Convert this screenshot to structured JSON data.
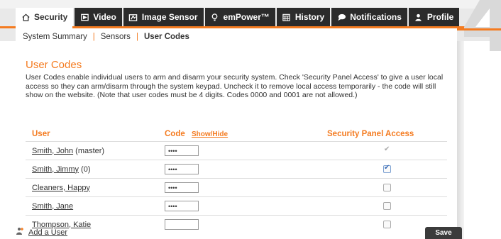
{
  "tabs": [
    {
      "label": "Security",
      "icon": "home-icon",
      "active": true
    },
    {
      "label": "Video",
      "icon": "video-icon",
      "active": false
    },
    {
      "label": "Image Sensor",
      "icon": "image-sensor-icon",
      "active": false
    },
    {
      "label": "emPower™",
      "icon": "lightbulb-icon",
      "active": false
    },
    {
      "label": "History",
      "icon": "calendar-icon",
      "active": false
    },
    {
      "label": "Notifications",
      "icon": "speech-bubble-icon",
      "active": false
    },
    {
      "label": "Profile",
      "icon": "person-icon",
      "active": false
    }
  ],
  "subnav": {
    "items": [
      "System Summary",
      "Sensors",
      "User Codes"
    ],
    "separator": "|"
  },
  "page": {
    "title": "User Codes",
    "description": "User Codes enable individual users to arm and disarm your security system. Check 'Security Panel Access' to give a user local access so they can arm/disarm through the system keypad. Uncheck it to remove local access temporarily - the code will still show on the website. (Note that user codes must be 4 digits. Codes 0000 and 0001 are not allowed.)"
  },
  "table": {
    "columns": {
      "user": "User",
      "code": "Code",
      "show_hide": "Show/Hide",
      "access": "Security Panel Access"
    },
    "rows": [
      {
        "name": "Smith, John",
        "suffix": " (master)",
        "code": "••••",
        "access": "checked-disabled"
      },
      {
        "name": "Smith, Jimmy",
        "suffix": " (0)",
        "code": "••••",
        "access": "checked"
      },
      {
        "name": "Cleaners, Happy",
        "suffix": "",
        "code": "••••",
        "access": "unchecked"
      },
      {
        "name": "Smith, Jane",
        "suffix": "",
        "code": "••••",
        "access": "unchecked"
      },
      {
        "name": "Thompson, Katie",
        "suffix": "",
        "code": "",
        "access": "unchecked"
      }
    ]
  },
  "actions": {
    "add_user": "Add a User",
    "save": "Save"
  },
  "colors": {
    "accent": "#f47b20",
    "tab_bg": "#2b2b2b",
    "button_bg": "#3b3b3b"
  }
}
